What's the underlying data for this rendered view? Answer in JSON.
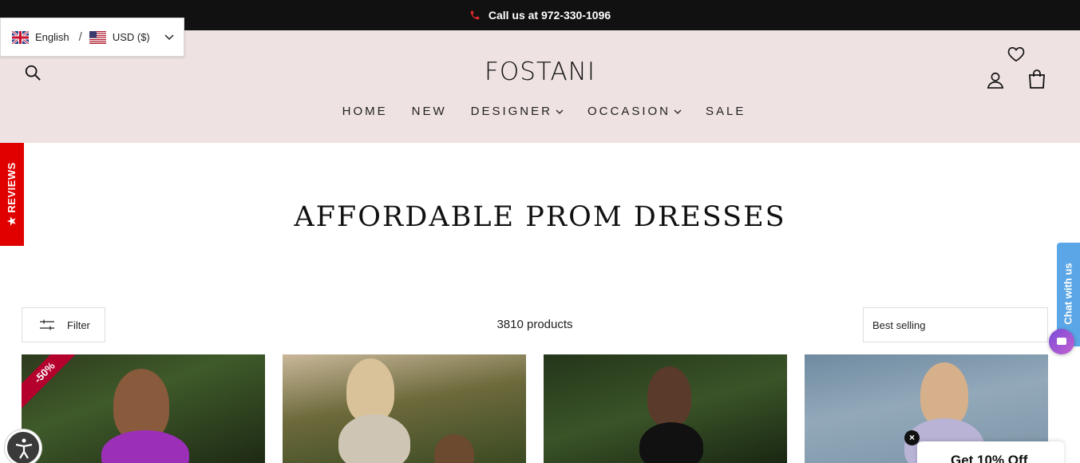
{
  "announcement": {
    "text": "Call us at 972-330-1096"
  },
  "locale": {
    "language": "English",
    "separator": "/",
    "currency": "USD ($)"
  },
  "header": {
    "logo": "FOSTANI"
  },
  "nav": {
    "items": [
      {
        "label": "HOME",
        "dropdown": false
      },
      {
        "label": "NEW",
        "dropdown": false
      },
      {
        "label": "DESIGNER",
        "dropdown": true
      },
      {
        "label": "OCCASION",
        "dropdown": true
      },
      {
        "label": "SALE",
        "dropdown": false
      }
    ]
  },
  "reviews_tab": {
    "label": "★ REVIEWS"
  },
  "collection": {
    "title": "AFFORDABLE PROM DRESSES",
    "filter_label": "Filter",
    "product_count": "3810 products",
    "sort_value": "Best selling"
  },
  "products": [
    {
      "badge": "-50%"
    },
    {
      "badge": ""
    },
    {
      "badge": ""
    },
    {
      "badge": ""
    }
  ],
  "chat": {
    "label": "Chat with us"
  },
  "promo": {
    "text": "Get 10% Off",
    "close": "×"
  },
  "colors": {
    "topbar": "#111111",
    "header_bg": "#efe2e2",
    "reviews": "#e00000",
    "chat": "#5aa6e6",
    "sale_badge": "#b3002d"
  }
}
